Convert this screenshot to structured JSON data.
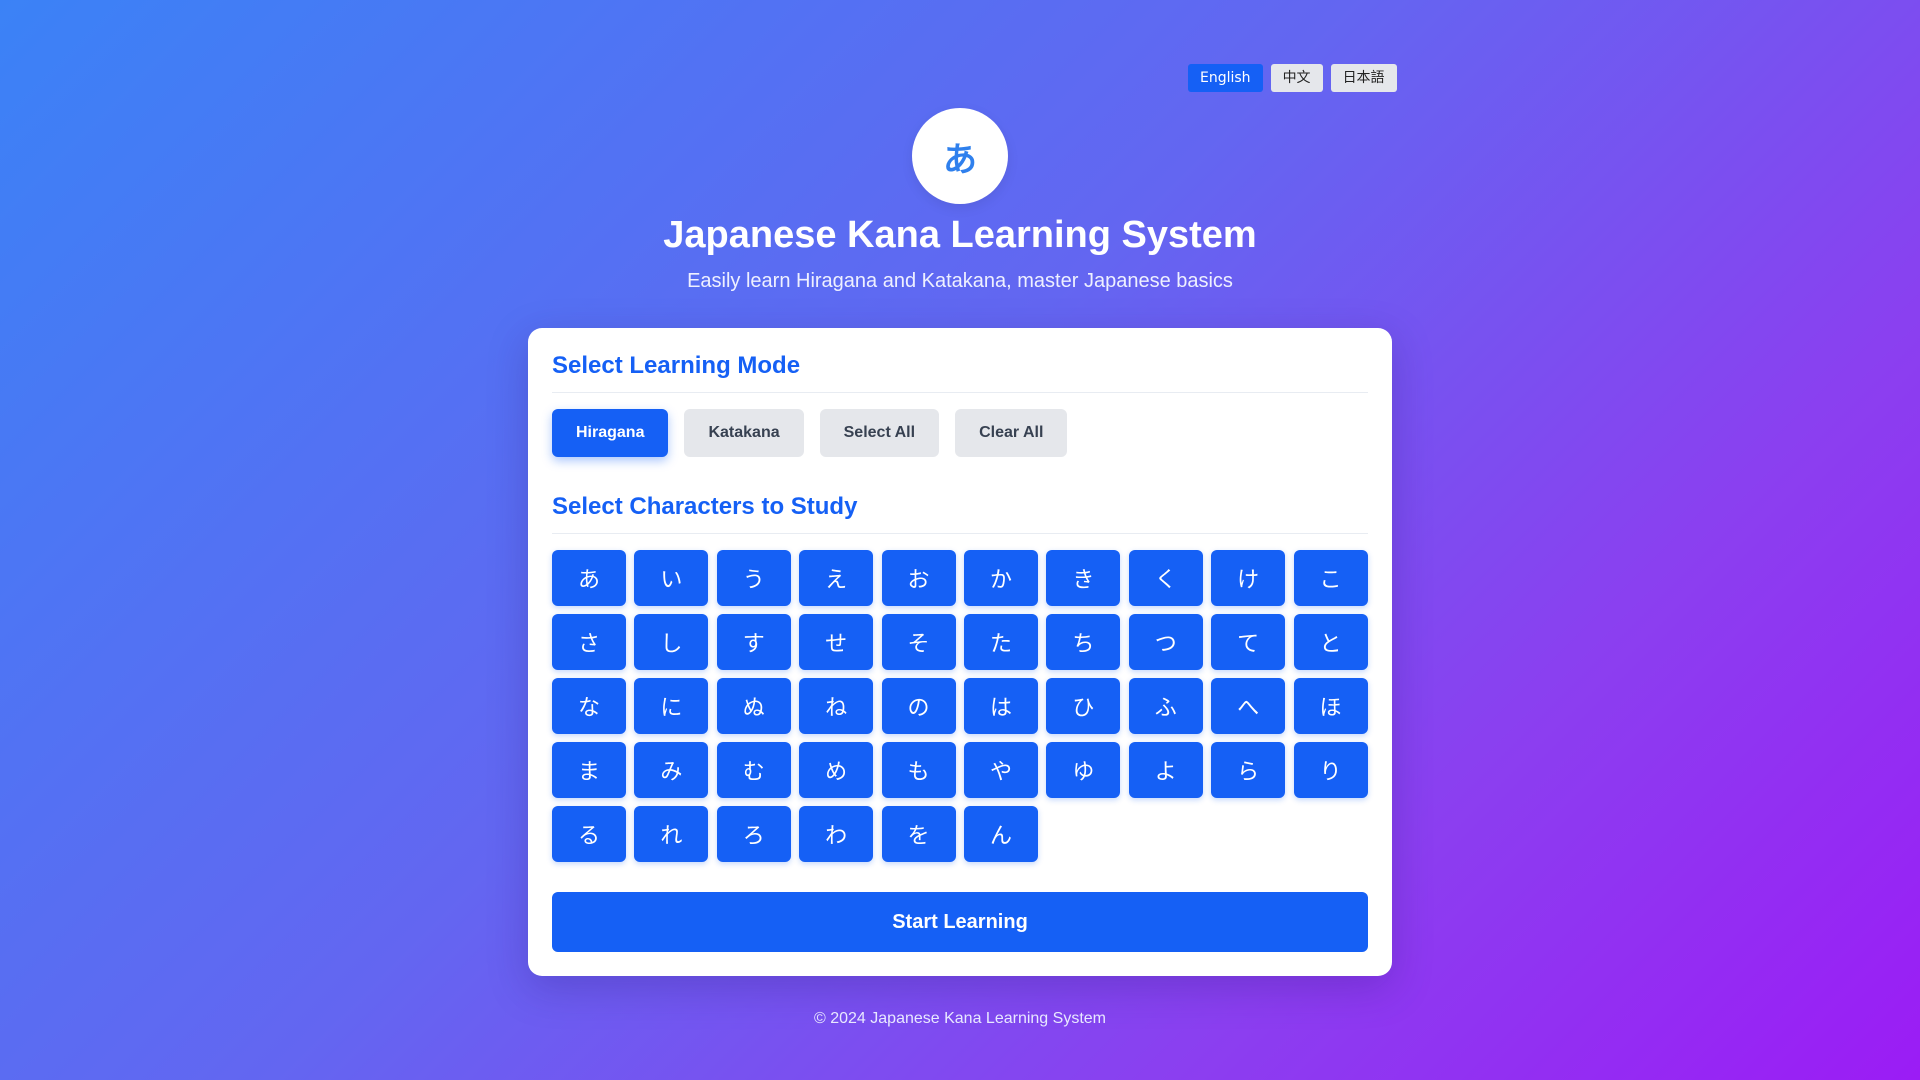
{
  "language_bar": {
    "languages": [
      {
        "label": "English",
        "active": true
      },
      {
        "label": "中文",
        "active": false
      },
      {
        "label": "日本語",
        "active": false
      }
    ]
  },
  "header": {
    "logo_glyph": "あ",
    "title": "Japanese Kana Learning System",
    "subtitle": "Easily learn Hiragana and Katakana, master Japanese basics"
  },
  "mode_section": {
    "title": "Select Learning Mode",
    "buttons": [
      {
        "label": "Hiragana",
        "active": true
      },
      {
        "label": "Katakana",
        "active": false
      },
      {
        "label": "Select All",
        "active": false
      },
      {
        "label": "Clear All",
        "active": false
      }
    ]
  },
  "chars_section": {
    "title": "Select Characters to Study",
    "characters": [
      "あ",
      "い",
      "う",
      "え",
      "お",
      "か",
      "き",
      "く",
      "け",
      "こ",
      "さ",
      "し",
      "す",
      "せ",
      "そ",
      "た",
      "ち",
      "つ",
      "て",
      "と",
      "な",
      "に",
      "ぬ",
      "ね",
      "の",
      "は",
      "ひ",
      "ふ",
      "へ",
      "ほ",
      "ま",
      "み",
      "む",
      "め",
      "も",
      "や",
      "ゆ",
      "よ",
      "ら",
      "り",
      "る",
      "れ",
      "ろ",
      "わ",
      "を",
      "ん"
    ]
  },
  "start_button": {
    "label": "Start Learning"
  },
  "footer": {
    "text": "© 2024 Japanese Kana Learning System"
  },
  "colors": {
    "accent": "#1560f5",
    "button_inactive": "#e5e7eb",
    "background_start": "#3b82f6",
    "background_end": "#9b1cf5"
  }
}
